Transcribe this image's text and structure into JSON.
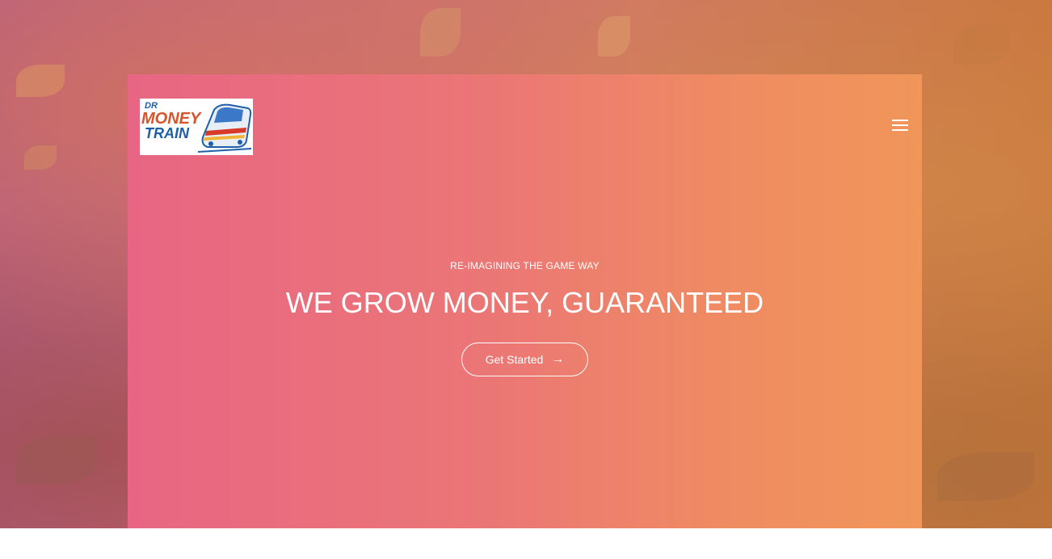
{
  "logo": {
    "line1": "DR",
    "line2": "MONEY",
    "line3": "TRAIN",
    "icon": "train-logo-icon"
  },
  "header": {
    "menu_icon": "hamburger-menu-icon"
  },
  "hero": {
    "tagline": "RE-IMAGINING THE GAME WAY",
    "headline": "WE GROW MONEY, GUARANTEED",
    "cta_label": "Get Started",
    "cta_icon": "arrow-right-icon",
    "cta_arrow": "→"
  },
  "colors": {
    "gradient_start": "#e86683",
    "gradient_end": "#f0965a",
    "text": "#ffffff"
  }
}
